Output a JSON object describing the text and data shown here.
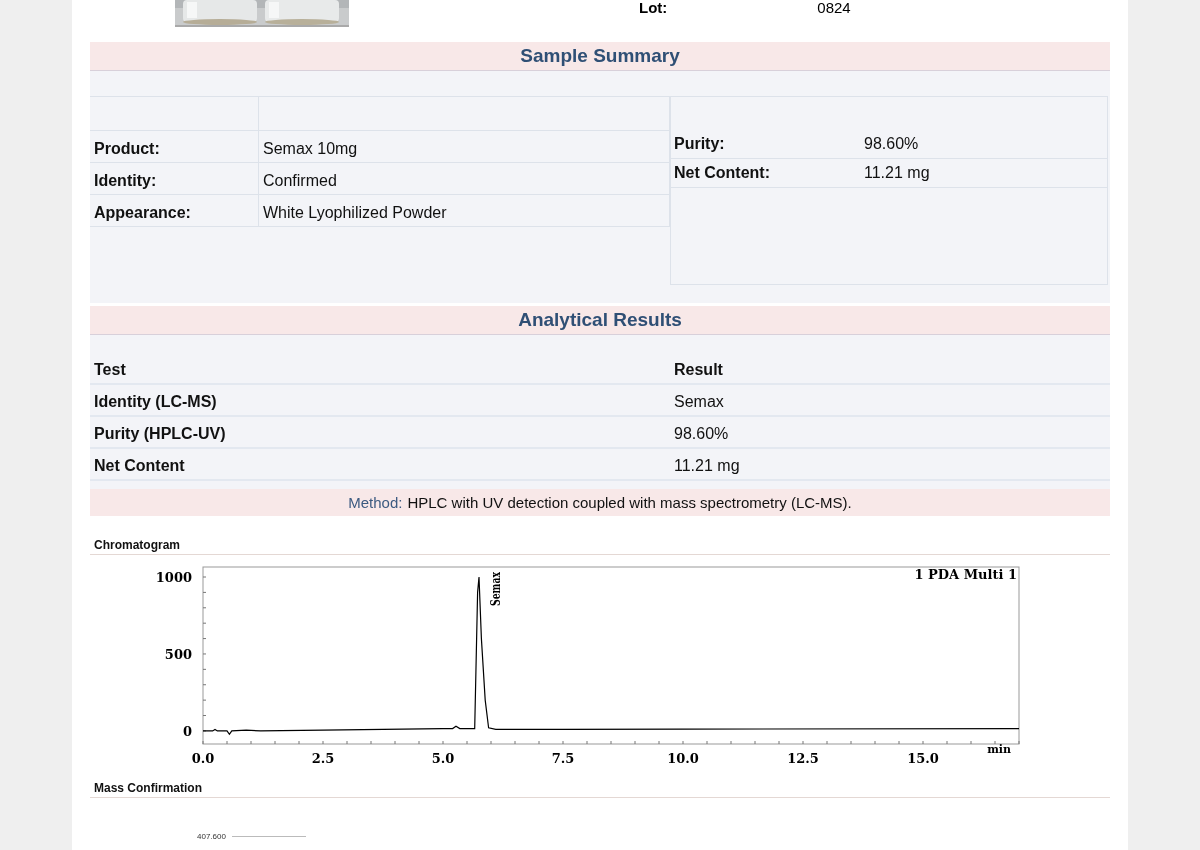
{
  "header": {
    "lot_label": "Lot:",
    "lot_value": "0824"
  },
  "sample_summary": {
    "title": "Sample Summary",
    "left_rows": [
      {
        "label": "Product:",
        "value": "Semax 10mg"
      },
      {
        "label": "Identity:",
        "value": "Confirmed"
      },
      {
        "label": "Appearance:",
        "value": "White Lyophilized Powder"
      }
    ],
    "right_rows": [
      {
        "label": "Purity:",
        "value": "98.60%"
      },
      {
        "label": "Net Content:",
        "value": "11.21 mg"
      }
    ]
  },
  "analytical_results": {
    "title": "Analytical Results",
    "columns": [
      "Test",
      "Result"
    ],
    "rows": [
      [
        "Identity (LC-MS)",
        "Semax"
      ],
      [
        "Purity (HPLC-UV)",
        "98.60%"
      ],
      [
        "Net Content",
        "11.21 mg"
      ]
    ]
  },
  "method": {
    "label": "Method:",
    "text": "HPLC with UV detection coupled with mass spectrometry (LC-MS)."
  },
  "chromatogram": {
    "title": "Chromatogram",
    "chart_data": {
      "type": "line",
      "xlabel": "min",
      "xlim": [
        0,
        17
      ],
      "ylim": [
        -85,
        1065
      ],
      "xticks": [
        {
          "value": 0,
          "label": "0.0"
        },
        {
          "value": 2.5,
          "label": "2.5"
        },
        {
          "value": 5,
          "label": "5.0"
        },
        {
          "value": 7.5,
          "label": "7.5"
        },
        {
          "value": 10,
          "label": "10.0"
        },
        {
          "value": 12.5,
          "label": "12.5"
        },
        {
          "value": 15,
          "label": "15.0"
        }
      ],
      "yticks": [
        0,
        500,
        1000
      ],
      "x": [
        0,
        0.2,
        0.25,
        0.3,
        0.5,
        0.55,
        0.6,
        0.9,
        1.2,
        2.5,
        5.0,
        5.2,
        5.27,
        5.35,
        5.6,
        5.66,
        5.72,
        5.75,
        5.8,
        5.88,
        5.95,
        6.1,
        7.5,
        10,
        17
      ],
      "series": [
        {
          "name": "1 PDA Multi 1",
          "color": "#000000",
          "values": [
            0,
            0,
            10,
            0,
            0,
            -22,
            0,
            5,
            0,
            5,
            15,
            15,
            30,
            15,
            15,
            15,
            900,
            1000,
            600,
            200,
            20,
            10,
            10,
            12,
            15
          ]
        }
      ],
      "annotations": [
        {
          "x": 5.75,
          "text": "Semax"
        }
      ]
    }
  },
  "mass_confirmation": {
    "title": "Mass Confirmation",
    "axis_label": "407.600"
  }
}
